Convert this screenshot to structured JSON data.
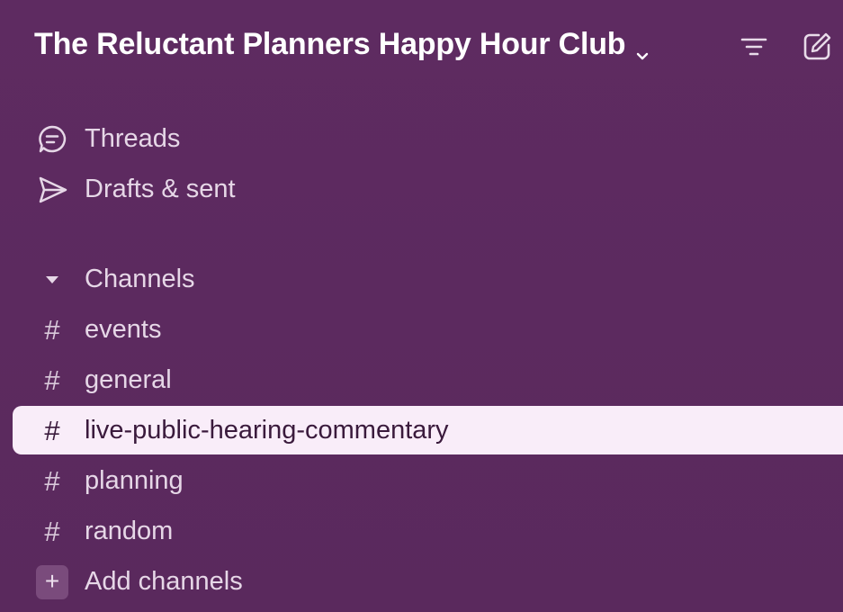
{
  "workspace": {
    "name": "The Reluctant Planners Happy Hour Club"
  },
  "icons": {
    "workspace_menu": "chevron-down-icon",
    "filter": "filter-icon",
    "compose": "compose-icon",
    "threads": "threads-icon",
    "drafts": "send-icon",
    "channels_toggle": "caret-down-icon",
    "channel": "hash-icon",
    "add": "plus-icon"
  },
  "nav": {
    "threads_label": "Threads",
    "drafts_label": "Drafts & sent"
  },
  "channels": {
    "section_label": "Channels",
    "items": [
      {
        "label": "events",
        "selected": false
      },
      {
        "label": "general",
        "selected": false
      },
      {
        "label": "live-public-hearing-commentary",
        "selected": true
      },
      {
        "label": "planning",
        "selected": false
      },
      {
        "label": "random",
        "selected": false
      }
    ],
    "add_label": "Add channels",
    "hash_glyph": "#",
    "add_glyph": "+"
  },
  "colors": {
    "sidebar_bg": "#5b2a5e",
    "selected_bg": "#f9edf9",
    "selected_text": "#3a1a3c",
    "text": "#e6d7e7"
  }
}
